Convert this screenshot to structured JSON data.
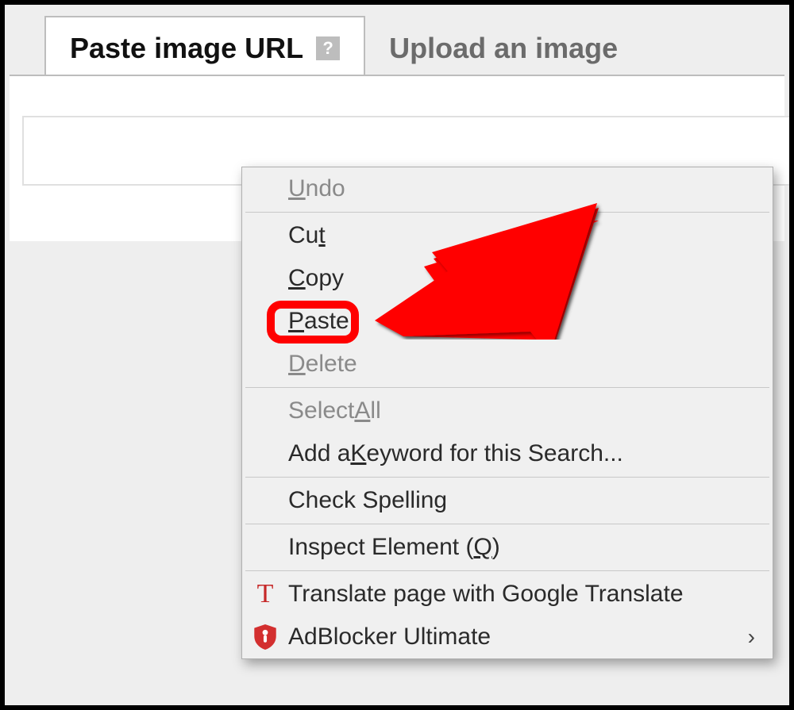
{
  "tabs": {
    "active": {
      "label": "Paste image URL",
      "help_icon": "?"
    },
    "inactive": {
      "label": "Upload an image"
    }
  },
  "url_input": {
    "value": "",
    "placeholder": ""
  },
  "context_menu": {
    "undo": {
      "pre": "",
      "u": "U",
      "post": "ndo",
      "disabled": true
    },
    "cut": {
      "pre": "Cu",
      "u": "t",
      "post": "",
      "disabled": false
    },
    "copy": {
      "pre": "",
      "u": "C",
      "post": "opy",
      "disabled": false
    },
    "paste": {
      "pre": "",
      "u": "P",
      "post": "aste",
      "disabled": false
    },
    "delete": {
      "pre": "",
      "u": "D",
      "post": "elete",
      "disabled": true
    },
    "select_all": {
      "pre": "Select ",
      "u": "A",
      "post": "ll",
      "disabled": true
    },
    "add_keyword": {
      "pre": "Add a ",
      "u": "K",
      "post": "eyword for this Search...",
      "disabled": false
    },
    "check_spell": {
      "pre": "Check Spelling",
      "u": "",
      "post": "",
      "disabled": false
    },
    "inspect": {
      "pre": "Inspect Element (",
      "u": "Q",
      "post": ")",
      "disabled": false
    },
    "translate": {
      "pre": "Translate page with Google Translate",
      "u": "",
      "post": "",
      "disabled": false
    },
    "adblocker": {
      "pre": "AdBlocker Ultimate",
      "u": "",
      "post": "",
      "disabled": false
    }
  },
  "icons": {
    "translate_glyph": "T",
    "submenu_arrow": "›"
  },
  "annotation": {
    "highlighted_item": "paste",
    "arrow_color": "#ff0000"
  }
}
